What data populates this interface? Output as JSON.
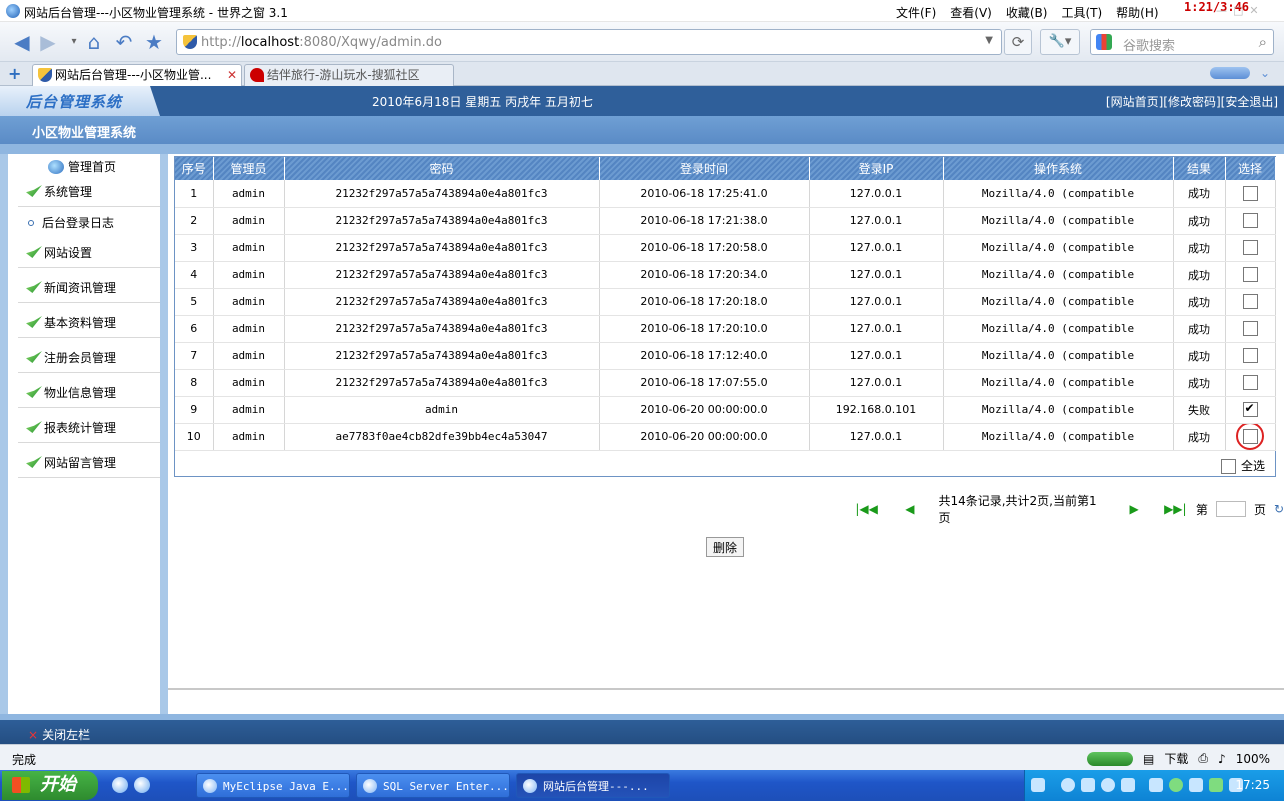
{
  "window": {
    "title": "网站后台管理---小区物业管理系统 - 世界之窗 3.1",
    "menu": [
      "文件(F)",
      "查看(V)",
      "收藏(B)",
      "工具(T)",
      "帮助(H)"
    ],
    "overlay_clock": "1:21/3:46"
  },
  "navbar": {
    "url_prefix": "http://",
    "url_host": "localhost",
    "url_rest": ":8080/Xqwy/admin.do",
    "search_placeholder": "谷歌搜索"
  },
  "tabs": [
    {
      "label": "网站后台管理---小区物业管..."
    },
    {
      "label": "结伴旅行-游山玩水-搜狐社区"
    }
  ],
  "app": {
    "logo": "后台管理系统",
    "date": "2010年6月18日 星期五 丙戌年 五月初七",
    "links": "[网站首页][修改密码][安全退出]",
    "subtitle": "小区物业管理系统",
    "close_left": "关闭左栏"
  },
  "sidebar": {
    "home": "管理首页",
    "items": [
      {
        "label": "系统管理"
      },
      {
        "label": "网站设置"
      },
      {
        "label": "新闻资讯管理"
      },
      {
        "label": "基本资料管理"
      },
      {
        "label": "注册会员管理"
      },
      {
        "label": "物业信息管理"
      },
      {
        "label": "报表统计管理"
      },
      {
        "label": "网站留言管理"
      }
    ],
    "sub_item": "后台登录日志"
  },
  "table": {
    "headers": [
      "序号",
      "管理员",
      "密码",
      "登录时间",
      "登录IP",
      "操作系统",
      "结果",
      "选择"
    ],
    "rows": [
      {
        "no": "1",
        "admin": "admin",
        "pwd": "21232f297a57a5a743894a0e4a801fc3",
        "time": "2010-06-18 17:25:41.0",
        "ip": "127.0.0.1",
        "os": "Mozilla/4.0 (compatible",
        "result": "成功",
        "checked": false
      },
      {
        "no": "2",
        "admin": "admin",
        "pwd": "21232f297a57a5a743894a0e4a801fc3",
        "time": "2010-06-18 17:21:38.0",
        "ip": "127.0.0.1",
        "os": "Mozilla/4.0 (compatible",
        "result": "成功",
        "checked": false
      },
      {
        "no": "3",
        "admin": "admin",
        "pwd": "21232f297a57a5a743894a0e4a801fc3",
        "time": "2010-06-18 17:20:58.0",
        "ip": "127.0.0.1",
        "os": "Mozilla/4.0 (compatible",
        "result": "成功",
        "checked": false
      },
      {
        "no": "4",
        "admin": "admin",
        "pwd": "21232f297a57a5a743894a0e4a801fc3",
        "time": "2010-06-18 17:20:34.0",
        "ip": "127.0.0.1",
        "os": "Mozilla/4.0 (compatible",
        "result": "成功",
        "checked": false
      },
      {
        "no": "5",
        "admin": "admin",
        "pwd": "21232f297a57a5a743894a0e4a801fc3",
        "time": "2010-06-18 17:20:18.0",
        "ip": "127.0.0.1",
        "os": "Mozilla/4.0 (compatible",
        "result": "成功",
        "checked": false
      },
      {
        "no": "6",
        "admin": "admin",
        "pwd": "21232f297a57a5a743894a0e4a801fc3",
        "time": "2010-06-18 17:20:10.0",
        "ip": "127.0.0.1",
        "os": "Mozilla/4.0 (compatible",
        "result": "成功",
        "checked": false
      },
      {
        "no": "7",
        "admin": "admin",
        "pwd": "21232f297a57a5a743894a0e4a801fc3",
        "time": "2010-06-18 17:12:40.0",
        "ip": "127.0.0.1",
        "os": "Mozilla/4.0 (compatible",
        "result": "成功",
        "checked": false
      },
      {
        "no": "8",
        "admin": "admin",
        "pwd": "21232f297a57a5a743894a0e4a801fc3",
        "time": "2010-06-18 17:07:55.0",
        "ip": "127.0.0.1",
        "os": "Mozilla/4.0 (compatible",
        "result": "成功",
        "checked": false
      },
      {
        "no": "9",
        "admin": "admin",
        "pwd": "admin",
        "time": "2010-06-20 00:00:00.0",
        "ip": "192.168.0.101",
        "os": "Mozilla/4.0 (compatible",
        "result": "失败",
        "checked": true
      },
      {
        "no": "10",
        "admin": "admin",
        "pwd": "ae7783f0ae4cb82dfe39bb4ec4a53047",
        "time": "2010-06-20 00:00:00.0",
        "ip": "127.0.0.1",
        "os": "Mozilla/4.0 (compatible",
        "result": "成功",
        "checked": false
      }
    ],
    "select_all": "全选"
  },
  "pager": {
    "summary": "共14条记录,共计2页,当前第1页",
    "page_prefix": "第",
    "page_suffix": "页"
  },
  "actions": {
    "delete": "删除"
  },
  "status": {
    "left": "完成",
    "download": "下载",
    "zoom": "100%"
  },
  "taskbar": {
    "start": "开始",
    "tasks": [
      "MyEclipse Java E...",
      "SQL Server Enter...",
      "网站后台管理---..."
    ],
    "time": "17:25"
  },
  "colors": {
    "header_blue": "#2f5f9a",
    "grid_header": "#5485c2",
    "accent_red": "#cc0000"
  }
}
